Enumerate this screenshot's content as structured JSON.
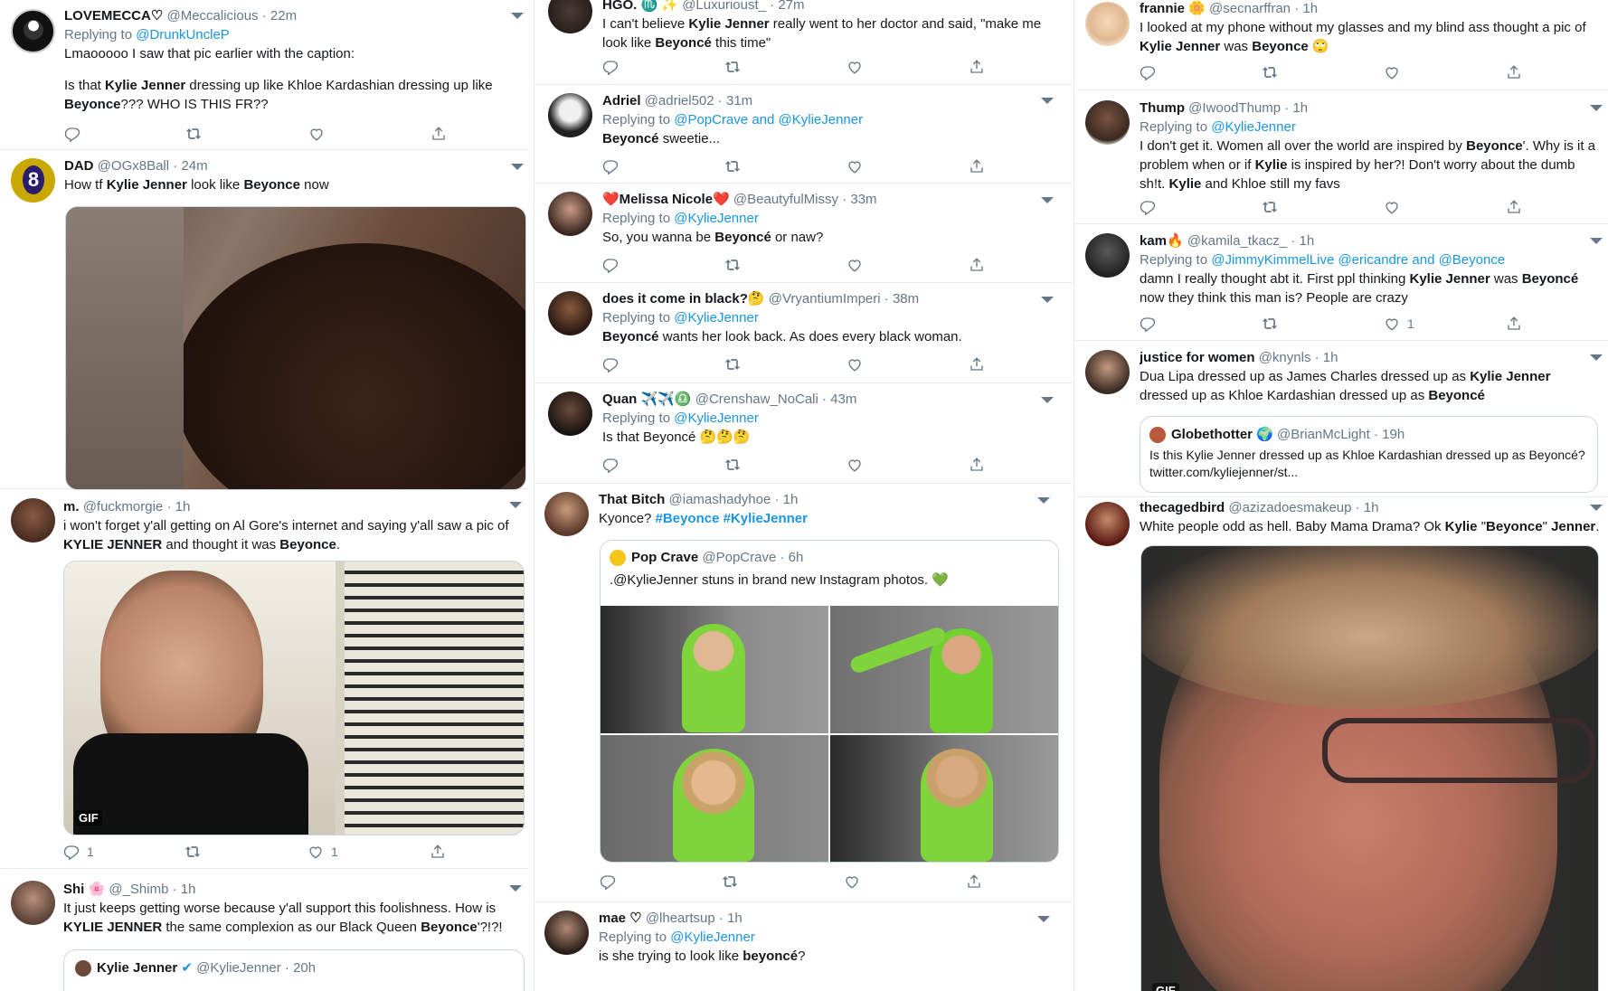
{
  "col1": {
    "t1": {
      "name": "LOVEMECCA♡",
      "handle": "@Meccalicious",
      "time": "22m",
      "replying": "Replying to",
      "reply_to": "@DrunkUncleP",
      "text_a": "Lmaooooo I saw that pic earlier with the caption:",
      "text_b1": "Is that ",
      "kw1": "Kylie Jenner",
      "text_b2": " dressing up like Khloe Kardashian dressing up like ",
      "kw2": "Beyonce",
      "text_b3": "??? WHO IS THIS FR??"
    },
    "t2": {
      "name": "DAD",
      "handle": "@OGx8Ball",
      "time": "24m",
      "t1": "How tf ",
      "kw1": "Kylie Jenner",
      "t2": " look like ",
      "kw2": "Beyonce",
      "t3": " now"
    },
    "t3": {
      "name": "m.",
      "handle": "@fuckmorgie",
      "time": "1h",
      "t1": "i won't forget y'all getting on Al Gore's internet and saying y'all saw a pic of ",
      "kw1": "KYLIE JENNER",
      "t2": " and thought it was ",
      "kw2": "Beyonce",
      "t3": ".",
      "gif": "GIF",
      "reply_count": "1",
      "like_count": "1"
    },
    "t4": {
      "name": "Shi 🌸",
      "handle": "@_Shimb",
      "time": "1h",
      "t1": "It just keeps getting worse because y'all support this foolishness. How is ",
      "kw1": "KYLIE JENNER",
      "t2": " the same complexion as our Black Queen ",
      "kw2": "Beyonce",
      "t3": "'?!?!",
      "quote_name": "Kylie Jenner",
      "quote_handle": "@KylieJenner",
      "quote_time": "20h"
    }
  },
  "col2": {
    "t1": {
      "name": "HGO. ♏ ✨",
      "handle": "@Luxurioust_",
      "time": "27m",
      "t1": "I can't believe ",
      "kw1": "Kylie Jenner",
      "t2": " really went to her doctor and said, \"make me look like ",
      "kw2": "Beyoncé",
      "t3": " this time\""
    },
    "t2": {
      "name": "Adriel",
      "handle": "@adriel502",
      "time": "31m",
      "replying": "Replying to",
      "reply_to": "@PopCrave and @KylieJenner",
      "kw1": "Beyoncé",
      "t1": " sweetie..."
    },
    "t3": {
      "name": "❤️Melissa Nicole❤️",
      "handle": "@BeautyfulMissy",
      "time": "33m",
      "replying": "Replying to",
      "reply_to": "@KylieJenner",
      "t1": "So, you wanna be ",
      "kw1": "Beyoncé",
      "t2": " or naw?"
    },
    "t4": {
      "name": "does it come in black?🤔",
      "handle": "@VryantiumImperi",
      "time": "38m",
      "replying": "Replying to",
      "reply_to": "@KylieJenner",
      "kw1": "Beyoncé",
      "t1": " wants her look back. As does every black woman."
    },
    "t5": {
      "name": "Quan ✈️✈️♎",
      "handle": "@Crenshaw_NoCali",
      "time": "43m",
      "replying": "Replying to",
      "reply_to": "@KylieJenner",
      "t1": "Is that Beyoncé 🤔🤔🤔"
    },
    "t6": {
      "name": "That Bitch",
      "handle": "@iamashadyhoe",
      "time": "1h",
      "t1": "Kyonce? ",
      "hash1": "#Beyonce",
      "hash2": "#KylieJenner",
      "quote_name": "Pop Crave",
      "quote_handle": "@PopCrave",
      "quote_time": "6h",
      "quote_text": ".@KylieJenner stuns in brand new Instagram photos. 💚"
    },
    "t7": {
      "name": "mae ♡",
      "handle": "@lheartsup",
      "time": "1h",
      "replying": "Replying to",
      "reply_to": "@KylieJenner",
      "t1": "is she trying to look like ",
      "kw1": "beyoncé",
      "t2": "?"
    }
  },
  "col3": {
    "t1": {
      "name": "frannie 🌼",
      "handle": "@secnarffran",
      "time": "1h",
      "t1": "I looked at my phone without my glasses and my blind ass thought a pic of ",
      "kw1": "Kylie Jenner",
      "t2": " was ",
      "kw2": "Beyonce",
      "t3": " 🙄"
    },
    "t2": {
      "name": "Thump",
      "handle": "@IwoodThump",
      "time": "1h",
      "replying": "Replying to",
      "reply_to": "@KylieJenner",
      "t1": "I don't get it. Women all over the world are inspired by ",
      "kw1": "Beyonce",
      "t2": "'. Why is it a problem when or if ",
      "kw2": "Kylie",
      "t3": " is inspired by her?! Don't worry about the dumb sh!t. ",
      "kw3": "Kylie",
      "t4": " and Khloe still my favs"
    },
    "t3": {
      "name": "kam🔥",
      "handle": "@kamila_tkacz_",
      "time": "1h",
      "replying": "Replying to",
      "reply_to": "@JimmyKimmelLive @ericandre and @Beyonce",
      "t1": "damn I really thought abt it. First ppl thinking ",
      "kw1": "Kylie Jenner",
      "t2": " was ",
      "kw2": "Beyoncé",
      "t3": " now they think this man is? People are crazy",
      "like_count": "1"
    },
    "t4": {
      "name": "justice for women",
      "handle": "@knynls",
      "time": "1h",
      "t1": "Dua Lipa dressed up as James Charles dressed up as ",
      "kw1": "Kylie Jenner",
      "t2": " dressed up as Khloe Kardashian dressed up as ",
      "kw2": "Beyoncé",
      "quote_name": "Globethotter 🌍",
      "quote_handle": "@BrianMcLight",
      "quote_time": "19h",
      "quote_text": "Is this Kylie Jenner dressed up as Khloe Kardashian dressed up as Beyoncé? twitter.com/kyliejenner/st..."
    },
    "t5": {
      "name": "thecagedbird",
      "handle": "@azizadoesmakeup",
      "time": "1h",
      "t1": "White people odd as hell. Baby Mama Drama? Ok ",
      "kw1": "Kylie",
      "t2": " \"",
      "kw2": "Beyonce",
      "t3": "\" ",
      "kw3": "Jenner",
      "t4": "...",
      "gif": "GIF"
    }
  },
  "sep": "·",
  "colors": {
    "link": "#1b95e0",
    "text": "#14171a",
    "meta": "#657786",
    "border": "#e6ecf0"
  }
}
